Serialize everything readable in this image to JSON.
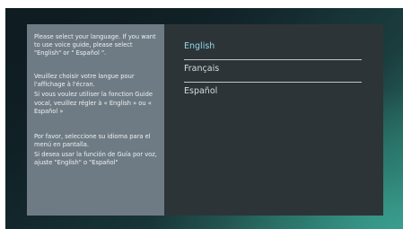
{
  "info_panel": {
    "english_text": "Please select your language. If you want to use voice guide, please select \"English\" or \" Español \".",
    "french_text_1": "Veuillez choisir votre langue pour l'affichage à l'écran.",
    "french_text_2": "Si vous voulez utiliser la fonction Guide vocal, veuillez régler à « English » ou « Español »",
    "spanish_text_1": "Por favor, seleccione su idioma para el menú en pantalla.",
    "spanish_text_2": "Si desea usar la función de Guía por voz, ajuste \"English\" o \"Español\""
  },
  "language_list": {
    "items": [
      {
        "label": "English",
        "focused": true
      },
      {
        "label": "Français",
        "focused": false
      },
      {
        "label": "Español",
        "focused": false
      }
    ]
  },
  "colors": {
    "focused_text": "#8fd8e9",
    "panel_bg": "#2d3438",
    "info_bg": "#6f7b84"
  }
}
